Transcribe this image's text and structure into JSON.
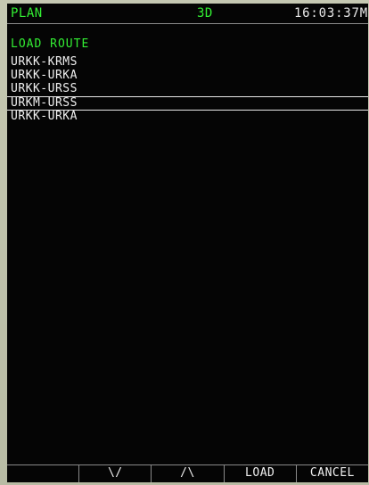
{
  "header": {
    "mode": "PLAN",
    "view": "3D",
    "time": "16:03:37M"
  },
  "panel": {
    "title": "LOAD ROUTE",
    "routes": [
      {
        "label": "URKK-KRMS",
        "selected": false
      },
      {
        "label": "URKK-URKA",
        "selected": false
      },
      {
        "label": "URKK-URSS",
        "selected": false
      },
      {
        "label": "URKM-URSS",
        "selected": true
      },
      {
        "label": "URKK-URKA",
        "selected": false
      }
    ]
  },
  "softkeys": [
    {
      "label": ""
    },
    {
      "label": "\\/"
    },
    {
      "label": "/\\"
    },
    {
      "label": "LOAD"
    },
    {
      "label": "CANCEL"
    }
  ],
  "colors": {
    "accent": "#33ee33",
    "text": "#f0f0f0",
    "screen_bg": "#050505",
    "bezel": "#bfc3ad"
  }
}
